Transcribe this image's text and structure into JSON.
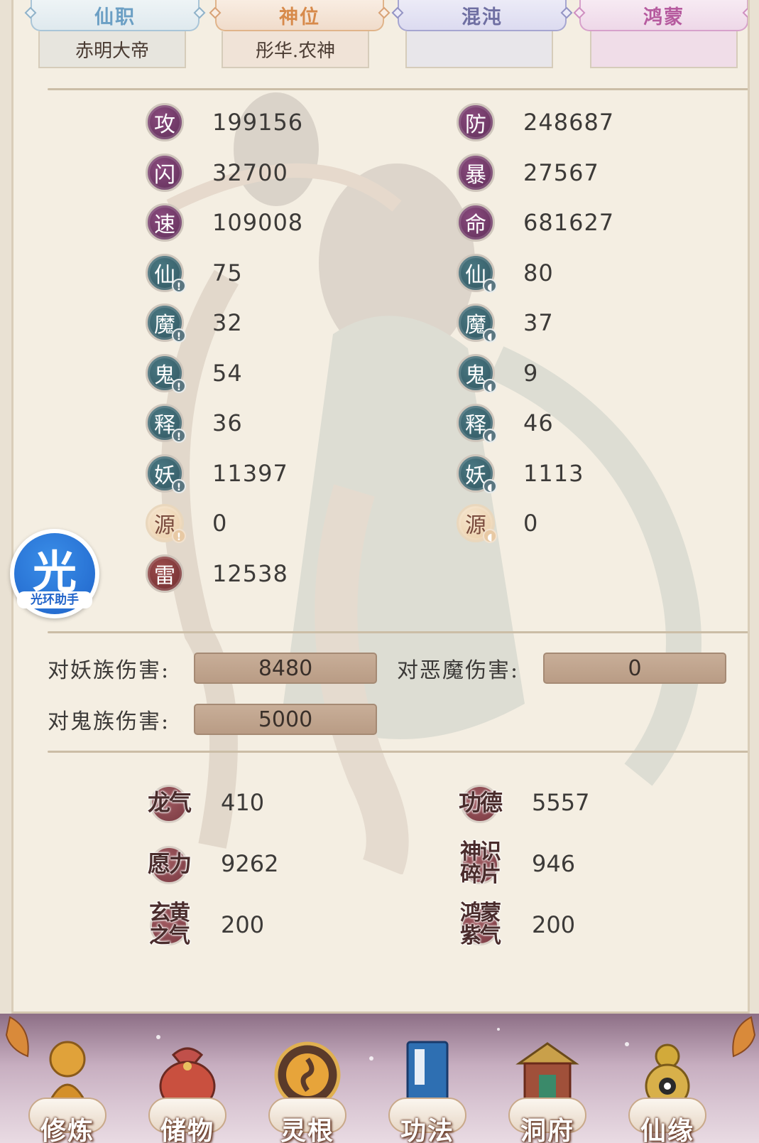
{
  "tabs": [
    {
      "title": "仙职",
      "value": "赤明大帝"
    },
    {
      "title": "神位",
      "value": "彤华.农神"
    },
    {
      "title": "混沌",
      "value": ""
    },
    {
      "title": "鸿蒙",
      "value": ""
    }
  ],
  "stats_left": [
    {
      "glyph": "攻",
      "value": "199156",
      "color": "purple",
      "mark": ""
    },
    {
      "glyph": "闪",
      "value": "32700",
      "color": "purple",
      "mark": ""
    },
    {
      "glyph": "速",
      "value": "109008",
      "color": "purple",
      "mark": ""
    },
    {
      "glyph": "仙",
      "value": "75",
      "color": "teal",
      "mark": "sword"
    },
    {
      "glyph": "魔",
      "value": "32",
      "color": "teal",
      "mark": "sword"
    },
    {
      "glyph": "鬼",
      "value": "54",
      "color": "teal",
      "mark": "sword"
    },
    {
      "glyph": "释",
      "value": "36",
      "color": "teal",
      "mark": "sword"
    },
    {
      "glyph": "妖",
      "value": "11397",
      "color": "teal",
      "mark": "sword"
    },
    {
      "glyph": "源",
      "value": "0",
      "color": "gold",
      "mark": "sword"
    },
    {
      "glyph": "雷",
      "value": "12538",
      "color": "red",
      "mark": ""
    }
  ],
  "stats_right": [
    {
      "glyph": "防",
      "value": "248687",
      "color": "purple",
      "mark": ""
    },
    {
      "glyph": "暴",
      "value": "27567",
      "color": "purple",
      "mark": ""
    },
    {
      "glyph": "命",
      "value": "681627",
      "color": "purple",
      "mark": ""
    },
    {
      "glyph": "仙",
      "value": "80",
      "color": "teal",
      "mark": "shield"
    },
    {
      "glyph": "魔",
      "value": "37",
      "color": "teal",
      "mark": "shield"
    },
    {
      "glyph": "鬼",
      "value": "9",
      "color": "teal",
      "mark": "shield"
    },
    {
      "glyph": "释",
      "value": "46",
      "color": "teal",
      "mark": "shield"
    },
    {
      "glyph": "妖",
      "value": "1113",
      "color": "teal",
      "mark": "shield"
    },
    {
      "glyph": "源",
      "value": "0",
      "color": "gold",
      "mark": "shield"
    }
  ],
  "damage": {
    "yao_label": "对妖族伤害:",
    "yao_value": "8480",
    "demon_label": "对恶魔伤害:",
    "demon_value": "0",
    "ghost_label": "对鬼族伤害:",
    "ghost_value": "5000"
  },
  "resources_left": [
    {
      "l1": "龙气",
      "l2": "",
      "value": "410"
    },
    {
      "l1": "愿力",
      "l2": "",
      "value": "9262"
    },
    {
      "l1": "玄黄",
      "l2": "之气",
      "value": "200"
    }
  ],
  "resources_right": [
    {
      "l1": "功德",
      "l2": "",
      "value": "5557"
    },
    {
      "l1": "神识",
      "l2": "碎片",
      "value": "946"
    },
    {
      "l1": "鸿蒙",
      "l2": "紫气",
      "value": "200"
    }
  ],
  "helper": {
    "glyph": "光",
    "caption": "光环助手"
  },
  "nav": [
    {
      "label": "修炼",
      "icon": "monk-icon"
    },
    {
      "label": "储物",
      "icon": "bag-icon"
    },
    {
      "label": "灵根",
      "icon": "triskelion-icon"
    },
    {
      "label": "功法",
      "icon": "book-icon"
    },
    {
      "label": "洞府",
      "icon": "palace-icon"
    },
    {
      "label": "仙缘",
      "icon": "gourd-icon"
    }
  ],
  "colors": {
    "purple": "#6e3766",
    "teal": "#3b6470",
    "gold": "#eed6b6",
    "red": "#7e3638",
    "resource": "#8a444c"
  }
}
